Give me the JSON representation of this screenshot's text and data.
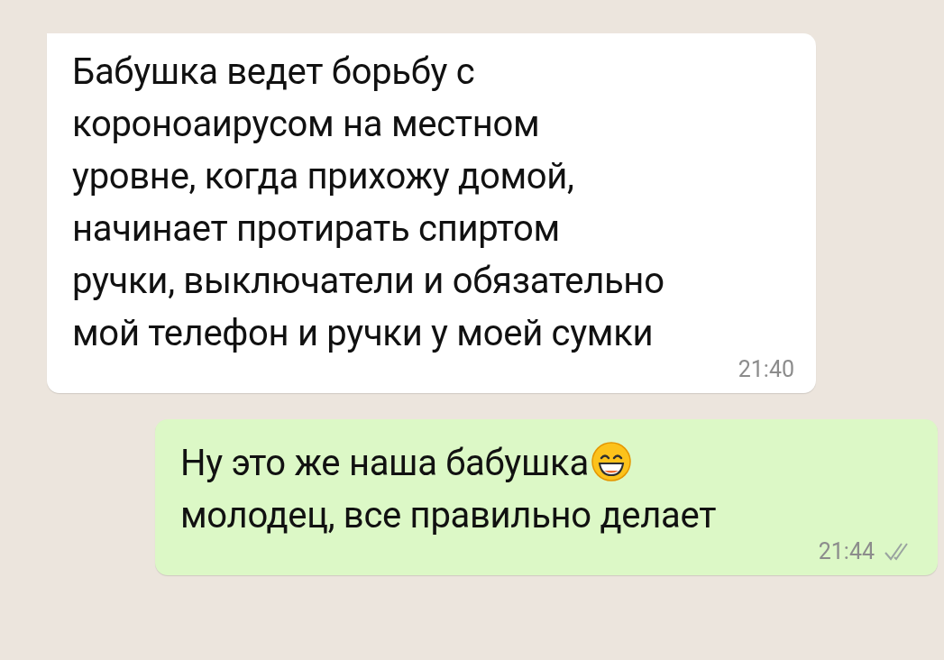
{
  "messages": [
    {
      "kind": "incoming",
      "text": "Бабушка ведет борьбу с\nкороноаирусом на местном\nуровне, когда прихожу домой,\nначинает протирать спиртом\nручки, выключатели и обязательно\nмой телефон и ручки у моей сумки",
      "time": "21:40"
    },
    {
      "kind": "outgoing",
      "parts": [
        {
          "kind": "text",
          "text": "Ну это же наша бабушка"
        },
        {
          "kind": "emoji"
        },
        {
          "kind": "break"
        },
        {
          "kind": "text",
          "text": "молодец, все правильно делает"
        }
      ],
      "time": "21:44",
      "read": false
    }
  ]
}
